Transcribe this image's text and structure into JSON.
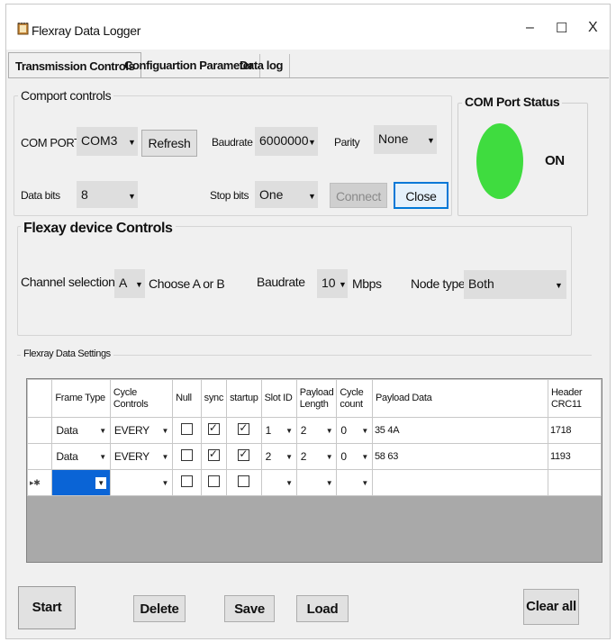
{
  "window": {
    "title": "Flexray Data Logger",
    "minimize": "–",
    "maximize": "☐",
    "close": "X"
  },
  "tabs": [
    {
      "label": "Transmission Controls",
      "active": true
    },
    {
      "label": "Configuartion Parameter",
      "active": false
    },
    {
      "label": "Data log",
      "active": false
    }
  ],
  "comport_controls": {
    "group_title": "Comport controls",
    "com_port_label": "COM PORT",
    "com_port_value": "COM3",
    "refresh_label": "Refresh",
    "baudrate_label": "Baudrate",
    "baudrate_value": "6000000",
    "parity_label": "Parity",
    "parity_value": "None",
    "data_bits_label": "Data bits",
    "data_bits_value": "8",
    "stop_bits_label": "Stop bits",
    "stop_bits_value": "One",
    "connect_label": "Connect",
    "close_label": "Close"
  },
  "com_port_status": {
    "title": "COM Port Status",
    "state": "ON",
    "indicator_color": "#3fdc3f"
  },
  "flexray_device_controls": {
    "title": "Flexay device Controls",
    "channel_label": "Channel selection",
    "channel_value": "A",
    "channel_hint": "Choose A or B",
    "baudrate_label": "Baudrate",
    "baudrate_value": "10",
    "baudrate_unit": "Mbps",
    "node_type_label": "Node type",
    "node_type_value": "Both"
  },
  "data_settings": {
    "title": "Flexray Data Settings",
    "columns": [
      "Frame Type",
      "Cycle Controls",
      "Null",
      "sync",
      "startup",
      "Slot ID",
      "Payload Length",
      "Cycle count",
      "Payload Data",
      "Header CRC11"
    ],
    "rows": [
      {
        "frame_type": "Data",
        "cycle_controls": "EVERY",
        "null": false,
        "sync": true,
        "startup": true,
        "slot_id": "1",
        "payload_length": "2",
        "cycle_count": "0",
        "payload_data": "35 4A",
        "header_crc11": "1718"
      },
      {
        "frame_type": "Data",
        "cycle_controls": "EVERY",
        "null": false,
        "sync": true,
        "startup": true,
        "slot_id": "2",
        "payload_length": "2",
        "cycle_count": "0",
        "payload_data": "58 63",
        "header_crc11": "1193"
      }
    ],
    "new_row_marker": "▸✱"
  },
  "actions": {
    "start": "Start",
    "delete": "Delete",
    "save": "Save",
    "load": "Load",
    "clear_all": "Clear all"
  }
}
